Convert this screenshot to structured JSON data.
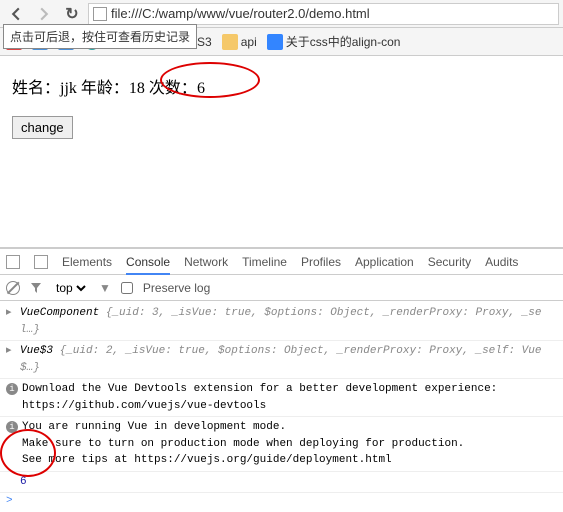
{
  "browser": {
    "url": "file:///C:/wamp/www/vue/router2.0/demo.html",
    "tooltip": "点击可后退，按住可查看历史记录"
  },
  "bookmarks": {
    "b0": "…",
    "b1": "…",
    "b2": "justify-content CSS3",
    "b3": "api",
    "b4": "关于css中的align-con"
  },
  "page": {
    "name_label": "姓名：",
    "name_value": "jjk",
    "age_label": "年龄：",
    "age_value": "18",
    "count_label": "次数：",
    "count_value": "6",
    "button": "change"
  },
  "devtools": {
    "tabs": {
      "elements": "Elements",
      "console": "Console",
      "network": "Network",
      "timeline": "Timeline",
      "profiles": "Profiles",
      "application": "Application",
      "security": "Security",
      "audits": "Audits"
    },
    "filter": {
      "context": "top",
      "preserve": "Preserve log"
    },
    "logs": {
      "l1_a": "VueComponent ",
      "l1_b": "{_uid: 3, _isVue: true, $options: Object, _renderProxy: Proxy, _sel…}",
      "l2_a": "Vue$3 ",
      "l2_b": "{_uid: 2, _isVue: true, $options: Object, _renderProxy: Proxy, _self: Vue$…}",
      "l3": "Download the Vue Devtools extension for a better development experience:\nhttps://github.com/vuejs/vue-devtools",
      "l4": "You are running Vue in development mode.\nMake sure to turn on production mode when deploying for production.\nSee more tips at https://vuejs.org/guide/deployment.html",
      "l5": "6",
      "prompt": ">"
    }
  }
}
